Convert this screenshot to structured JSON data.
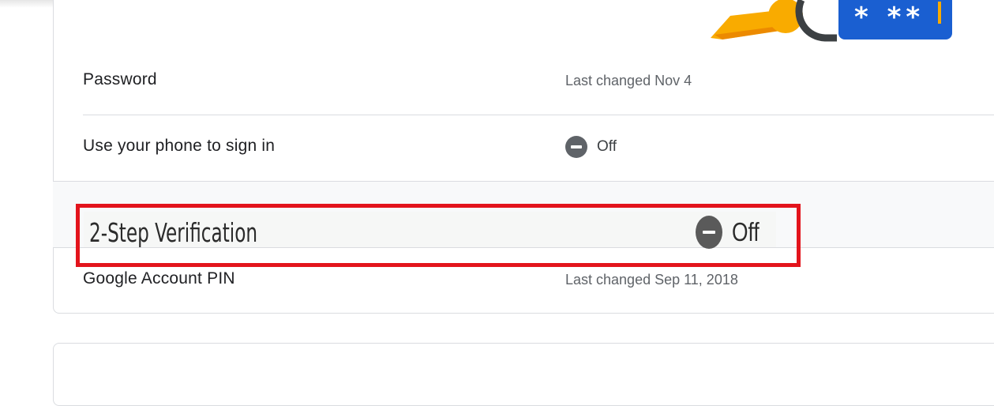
{
  "illustration": {
    "name": "password-key-illustration",
    "stars": "* **",
    "colors": {
      "key": "#f9ab00",
      "box": "#1a5fd1",
      "ring": "#3c4043"
    }
  },
  "security": {
    "rows": [
      {
        "label": "Password",
        "value": "Last changed Nov 4"
      },
      {
        "label": "Use your phone to sign in",
        "status": "Off"
      },
      {
        "label": "2-Step Verification",
        "status": "Off"
      },
      {
        "label": "Google Account PIN",
        "value": "Last changed Sep 11, 2018"
      }
    ]
  },
  "highlight": {
    "color": "#e3141c"
  }
}
